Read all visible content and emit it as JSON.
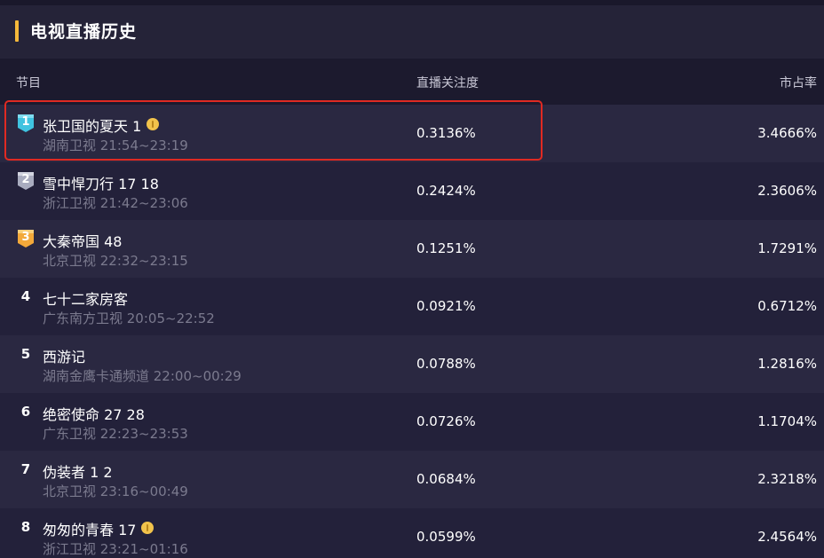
{
  "panel": {
    "title": "电视直播历史",
    "accent": "#f5b83a"
  },
  "columns": {
    "program": "节目",
    "attention": "直播关注度",
    "share": "市占率"
  },
  "rows": [
    {
      "rank": "1",
      "badge": "cyan",
      "name": "张卫国的夏天 1",
      "coin": true,
      "channel": "湖南卫视 21:54~23:19",
      "attention": "0.3136%",
      "share": "3.4666%",
      "highlighted": true
    },
    {
      "rank": "2",
      "badge": "silver",
      "name": "雪中悍刀行 17 18",
      "coin": false,
      "channel": "浙江卫视 21:42~23:06",
      "attention": "0.2424%",
      "share": "2.3606%"
    },
    {
      "rank": "3",
      "badge": "gold",
      "name": "大秦帝国 48",
      "coin": false,
      "channel": "北京卫视 22:32~23:15",
      "attention": "0.1251%",
      "share": "1.7291%"
    },
    {
      "rank": "4",
      "badge": "",
      "name": "七十二家房客",
      "coin": false,
      "channel": "广东南方卫视 20:05~22:52",
      "attention": "0.0921%",
      "share": "0.6712%"
    },
    {
      "rank": "5",
      "badge": "",
      "name": "西游记",
      "coin": false,
      "channel": "湖南金鹰卡通频道 22:00~00:29",
      "attention": "0.0788%",
      "share": "1.2816%"
    },
    {
      "rank": "6",
      "badge": "",
      "name": "绝密使命 27 28",
      "coin": false,
      "channel": "广东卫视 22:23~23:53",
      "attention": "0.0726%",
      "share": "1.1704%"
    },
    {
      "rank": "7",
      "badge": "",
      "name": "伪装者 1 2",
      "coin": false,
      "channel": "北京卫视 23:16~00:49",
      "attention": "0.0684%",
      "share": "2.3218%"
    },
    {
      "rank": "8",
      "badge": "",
      "name": "匆匆的青春 17",
      "coin": true,
      "channel": "浙江卫视 23:21~01:16",
      "attention": "0.0599%",
      "share": "2.4564%"
    }
  ],
  "colors": {
    "highlight": "#e02a22",
    "badge_cyan": "#3fc3e0",
    "badge_silver": "#a9acbf",
    "badge_gold": "#f3a93a",
    "coin": "#f2c34b"
  }
}
